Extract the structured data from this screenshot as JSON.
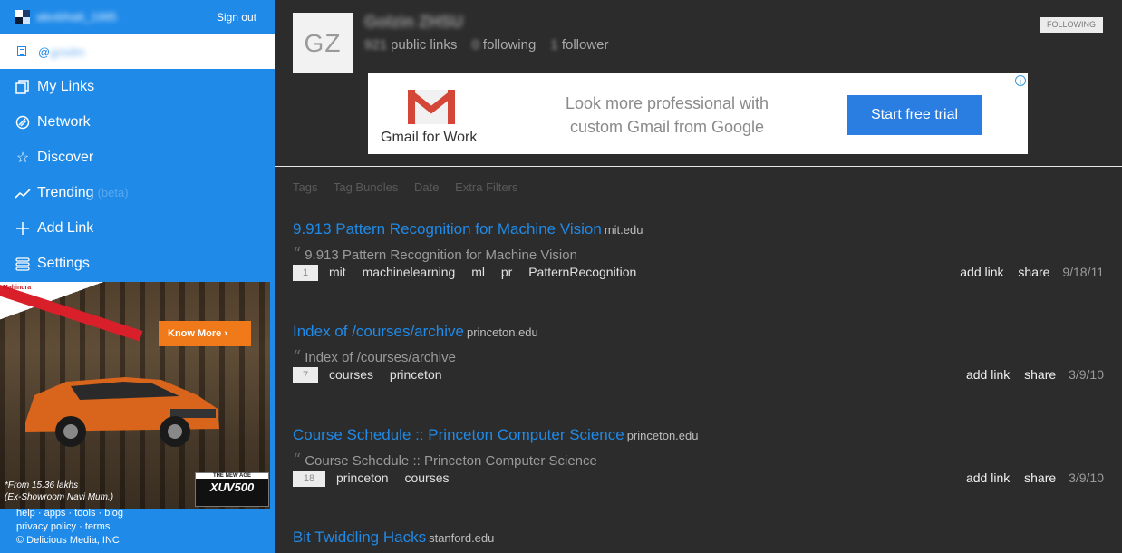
{
  "sidebar": {
    "username": "alexbhatt_1995",
    "sign_out": "Sign out",
    "profile_handle_prefix": "@",
    "profile_handle": "gzsdm",
    "nav": [
      {
        "label": "My Links",
        "icon": "my-links-icon"
      },
      {
        "label": "Network",
        "icon": "network-icon"
      },
      {
        "label": "Discover",
        "icon": "star-icon"
      },
      {
        "label": "Trending",
        "icon": "trending-icon",
        "badge": "(beta)"
      },
      {
        "label": "Add Link",
        "icon": "plus-icon"
      },
      {
        "label": "Settings",
        "icon": "settings-icon"
      }
    ],
    "ad": {
      "brand": "Mahindra",
      "cta": "Know More",
      "price_line1": "*From 15.36 lakhs",
      "price_line2": "(Ex-Showroom Navi Mum.)",
      "badge_top": "THE NEW AGE",
      "badge_model": "XUV500"
    },
    "footer": {
      "links": [
        "help",
        "apps",
        "tools",
        "blog",
        "privacy policy",
        "terms"
      ],
      "copyright": "© Delicious Media, INC"
    }
  },
  "profile": {
    "avatar_initials": "GZ",
    "name": "Golzin ZHSU",
    "public_links_count": "921",
    "public_links_label": "public links",
    "following_count": "0",
    "following_label": "following",
    "follower_count": "1",
    "follower_label": "follower",
    "follow_button": "FOLLOWING"
  },
  "gmail_ad": {
    "brand": "Gmail for Work",
    "text_line1": "Look more professional with",
    "text_line2": "custom Gmail from Google",
    "cta": "Start free trial",
    "info": "i"
  },
  "filters": [
    "Tags",
    "Tag Bundles",
    "Date",
    "Extra Filters"
  ],
  "links": [
    {
      "title": "9.913 Pattern Recognition for Machine Vision",
      "domain": "mit.edu",
      "quote": "9.913 Pattern Recognition for Machine Vision",
      "count": "1",
      "tags": [
        "mit",
        "machinelearning",
        "ml",
        "pr",
        "PatternRecognition"
      ],
      "add": "add link",
      "share": "share",
      "date": "9/18/11"
    },
    {
      "title": "Index of /courses/archive",
      "domain": "princeton.edu",
      "quote": "Index of /courses/archive",
      "count": "7",
      "tags": [
        "courses",
        "princeton"
      ],
      "add": "add link",
      "share": "share",
      "date": "3/9/10"
    },
    {
      "title": "Course Schedule :: Princeton Computer Science",
      "domain": "princeton.edu",
      "quote": "Course Schedule :: Princeton Computer Science",
      "count": "18",
      "tags": [
        "princeton",
        "courses"
      ],
      "add": "add link",
      "share": "share",
      "date": "3/9/10"
    },
    {
      "title": "Bit Twiddling Hacks",
      "domain": "stanford.edu"
    }
  ]
}
